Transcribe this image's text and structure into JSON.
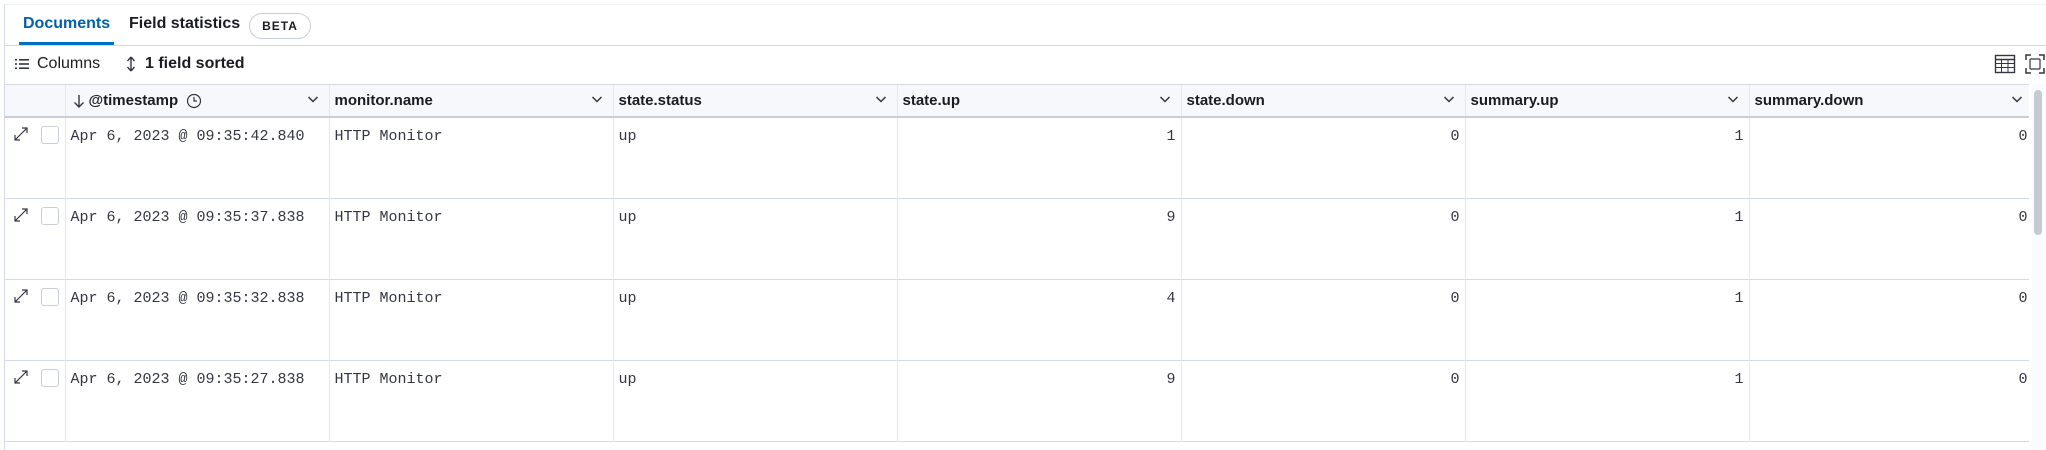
{
  "tabs": {
    "documents": "Documents",
    "field_statistics": "Field statistics",
    "beta_badge": "BETA"
  },
  "toolbar": {
    "columns_label": "Columns",
    "sort_label": "1 field sorted",
    "density_icon": "table-density-icon",
    "fullscreen_icon": "fullscreen-icon"
  },
  "grid": {
    "columns": [
      "@timestamp",
      "monitor.name",
      "state.status",
      "state.up",
      "state.down",
      "summary.up",
      "summary.down"
    ],
    "rows": [
      {
        "timestamp": "Apr 6, 2023 @ 09:35:42.840",
        "monitor_name": "HTTP Monitor",
        "state_status": "up",
        "state_up": "1",
        "state_down": "0",
        "summary_up": "1",
        "summary_down": "0"
      },
      {
        "timestamp": "Apr 6, 2023 @ 09:35:37.838",
        "monitor_name": "HTTP Monitor",
        "state_status": "up",
        "state_up": "9",
        "state_down": "0",
        "summary_up": "1",
        "summary_down": "0"
      },
      {
        "timestamp": "Apr 6, 2023 @ 09:35:32.838",
        "monitor_name": "HTTP Monitor",
        "state_status": "up",
        "state_up": "4",
        "state_down": "0",
        "summary_up": "1",
        "summary_down": "0"
      },
      {
        "timestamp": "Apr 6, 2023 @ 09:35:27.838",
        "monitor_name": "HTTP Monitor",
        "state_status": "up",
        "state_up": "9",
        "state_down": "0",
        "summary_up": "1",
        "summary_down": "0"
      }
    ]
  },
  "colors": {
    "accent": "#0071c2",
    "border": "#d3dae6",
    "header_bg": "#f7f8fc"
  }
}
